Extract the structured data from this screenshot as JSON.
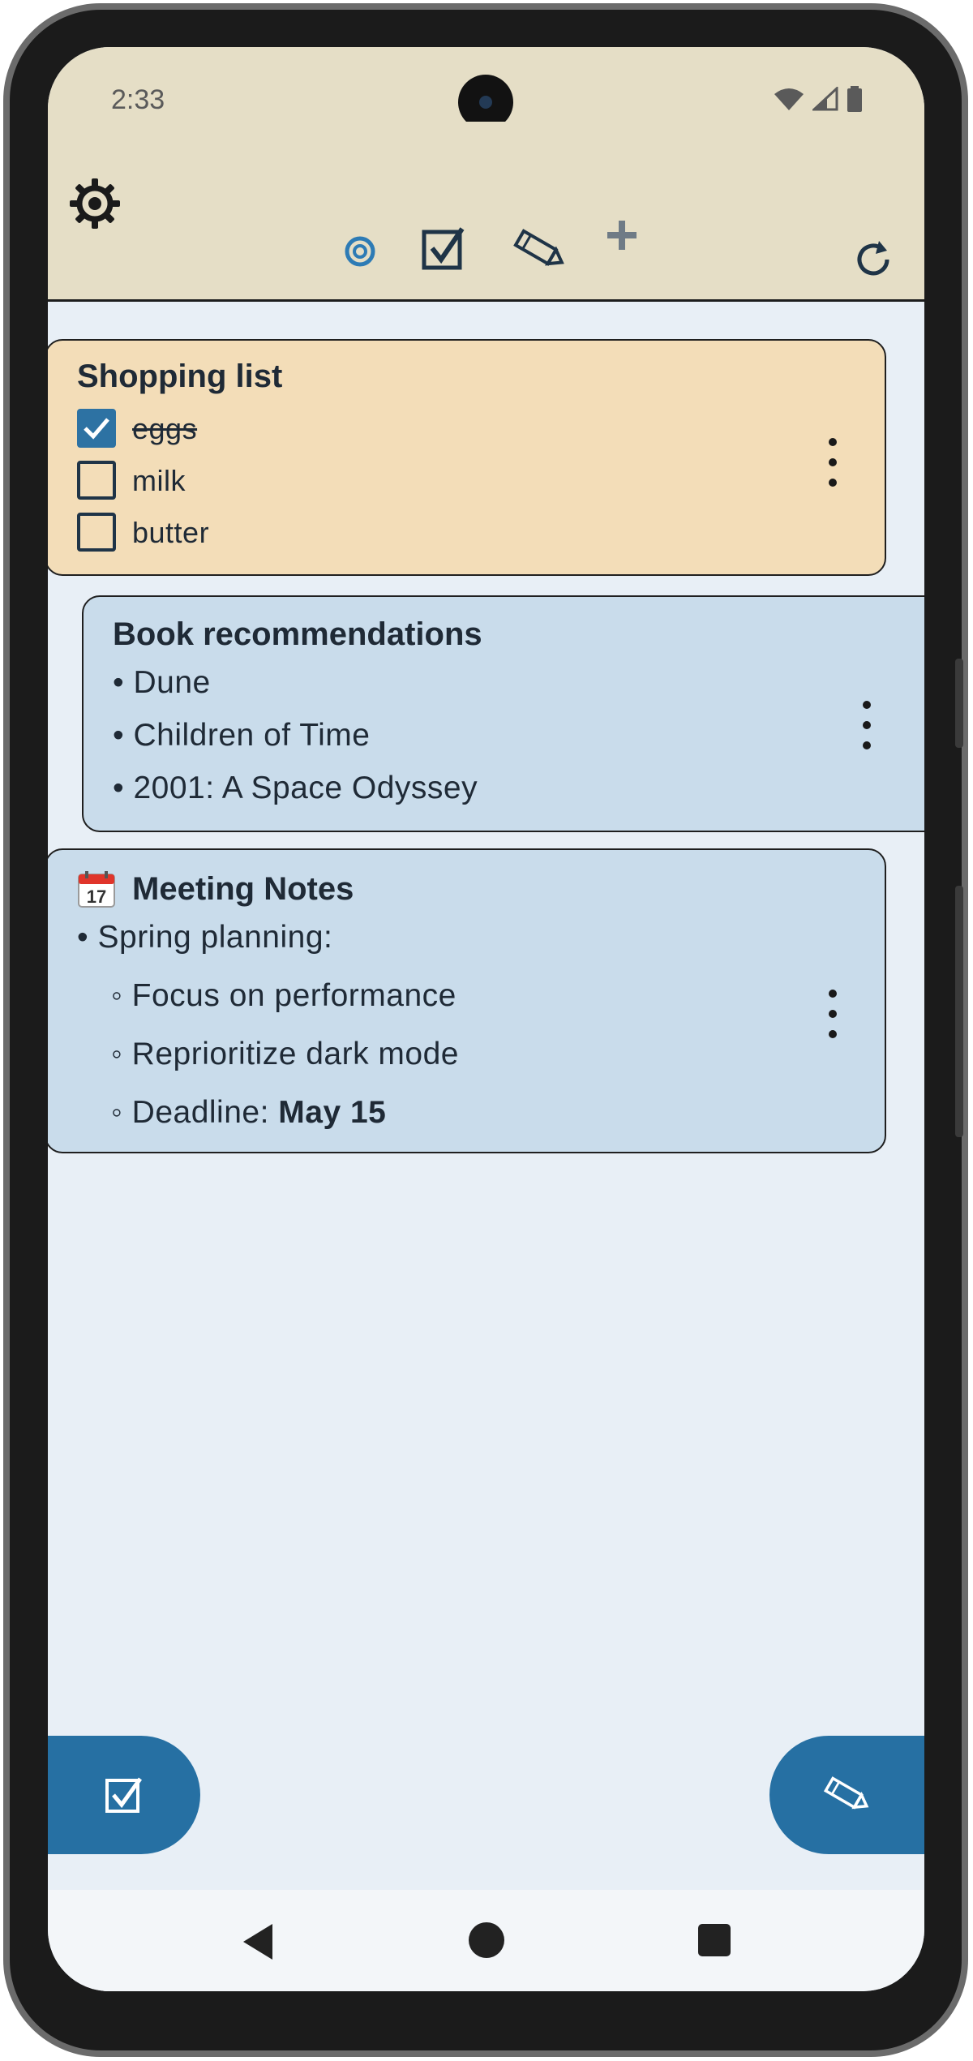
{
  "status_bar": {
    "time": "2:33"
  },
  "toolbar": {
    "icons": [
      "gear-icon",
      "target-icon",
      "checkbox-icon",
      "pencil-icon",
      "plus-icon",
      "refresh-icon"
    ]
  },
  "notes": [
    {
      "title": "Shopping list",
      "color": "#f3ddb8",
      "type": "checklist",
      "items": [
        {
          "text": "eggs",
          "checked": true
        },
        {
          "text": "milk",
          "checked": false
        },
        {
          "text": "butter",
          "checked": false
        }
      ]
    },
    {
      "title": "Book recommendations",
      "color": "#c9dceb",
      "type": "bullets",
      "items": [
        "• Dune",
        "• Children of Time",
        "• 2001: A Space Odyssey"
      ]
    },
    {
      "title": "Meeting Notes",
      "title_icon": "calendar-icon",
      "color": "#c9dceb",
      "type": "bullets",
      "items": [
        "• Spring planning:",
        "◦ Focus on performance",
        "◦ Reprioritize dark mode"
      ],
      "deadline_prefix": "◦ Deadline: ",
      "deadline_value": "May 15"
    }
  ],
  "fabs": {
    "left_icon": "checkbox-icon",
    "right_icon": "pencil-icon",
    "color": "#2670a3"
  },
  "nav": {
    "icons": [
      "back-icon",
      "home-icon",
      "recents-icon"
    ]
  }
}
